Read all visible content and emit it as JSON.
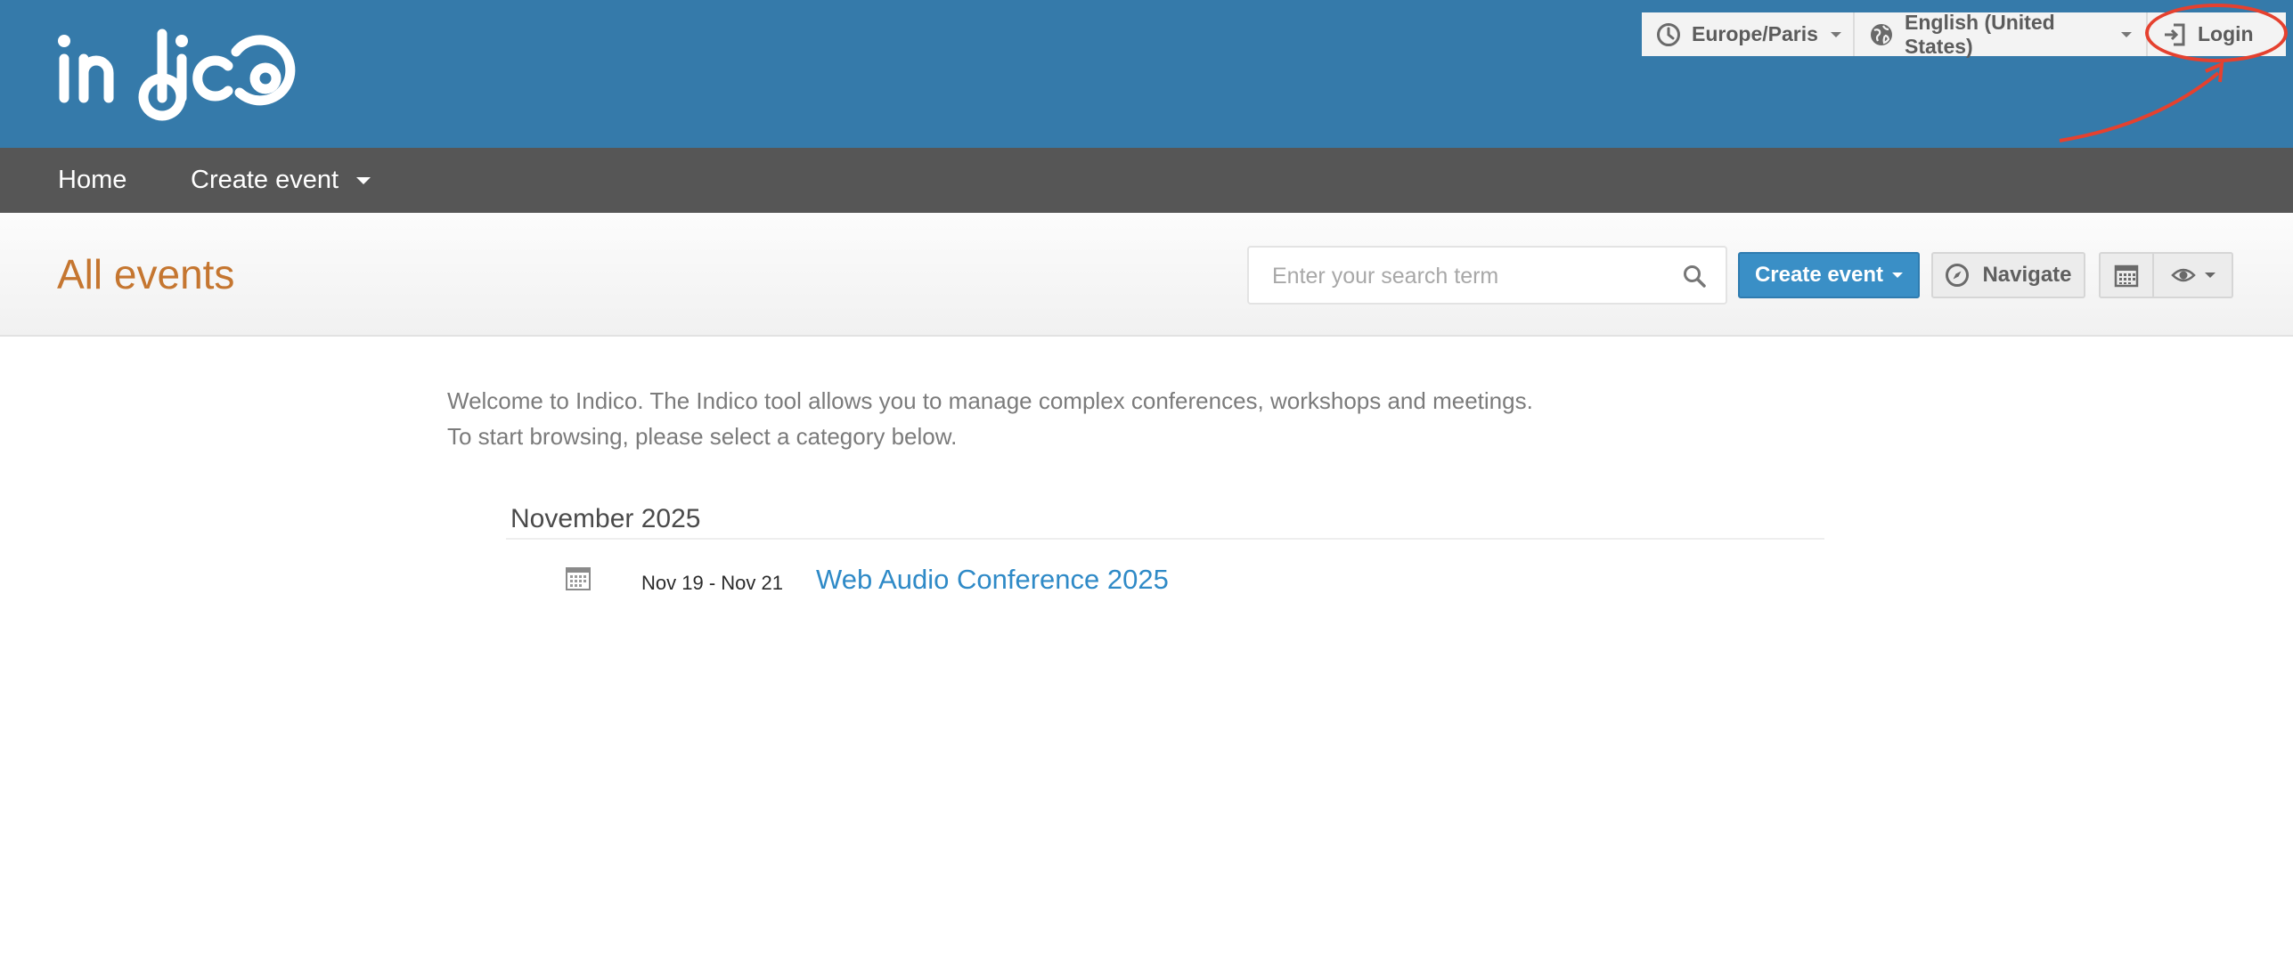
{
  "header": {
    "logo_text": "indico",
    "timezone": "Europe/Paris",
    "language": "English (United States)",
    "login_label": "Login"
  },
  "nav": {
    "home_label": "Home",
    "create_event_label": "Create event"
  },
  "page": {
    "title": "All events",
    "search_placeholder": "Enter your search term",
    "create_event_button": "Create event",
    "navigate_button": "Navigate"
  },
  "content": {
    "welcome_line1": "Welcome to Indico. The Indico tool allows you to manage complex conferences, workshops and meetings.",
    "welcome_line2": "To start browsing, please select a category below.",
    "month": "November 2025",
    "events": [
      {
        "dates": "Nov 19 - Nov 21",
        "title": "Web Audio Conference 2025"
      }
    ]
  },
  "colors": {
    "header_blue": "#357aaa",
    "nav_gray": "#565656",
    "title_orange": "#c57630",
    "link_blue": "#2f8ac7",
    "annotation_red": "#e5412f"
  },
  "icons": [
    "clock-icon",
    "globe-icon",
    "login-icon",
    "search-icon",
    "compass-icon",
    "calendar-icon",
    "eye-icon"
  ]
}
